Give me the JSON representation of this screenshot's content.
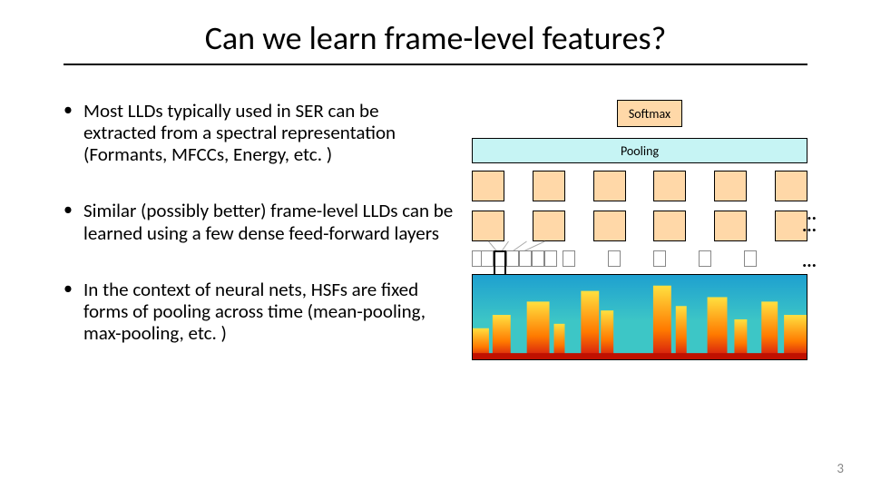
{
  "title": "Can we learn frame-level features?",
  "bullets": [
    "Most LLDs typically used in SER can be extracted from a spectral representation (Formants, MFCCs, Energy, etc. )",
    "Similar (possibly better) frame-level LLDs can be learned using a few dense feed-forward layers",
    "In the context of neural nets, HSFs are fixed forms of pooling across time (mean-pooling, max-pooling, etc. )"
  ],
  "diagram": {
    "softmax_label": "Softmax",
    "pooling_label": "Pooling",
    "ellipsis": "..."
  },
  "page_number": "3"
}
